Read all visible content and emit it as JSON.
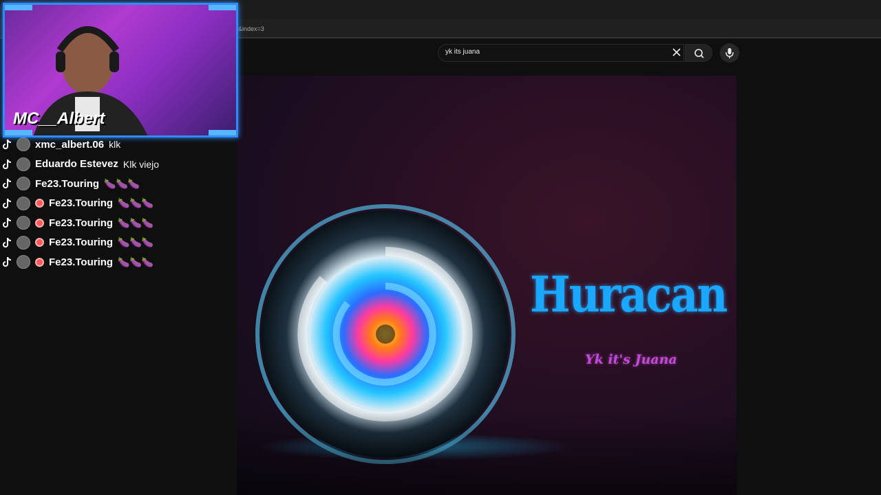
{
  "browser": {
    "url_fragment": "&index=3"
  },
  "search": {
    "value": "yk its juana"
  },
  "video": {
    "title": "Huracan",
    "artist": "Yk it's Juana"
  },
  "webcam": {
    "streamer_name": "MC__Albert"
  },
  "chat": {
    "messages": [
      {
        "user": "xmc_albert.06",
        "text": "klk",
        "badge": false
      },
      {
        "user": "Eduardo Estevez",
        "text": "Klk viejo",
        "badge": false
      },
      {
        "user": "Fe23.Touring",
        "text": "🍆🍆🍆",
        "badge": false
      },
      {
        "user": "Fe23.Touring",
        "text": "🍆🍆🍆",
        "badge": true
      },
      {
        "user": "Fe23.Touring",
        "text": "🍆🍆🍆",
        "badge": true
      },
      {
        "user": "Fe23.Touring",
        "text": "🍆🍆🍆",
        "badge": true
      },
      {
        "user": "Fe23.Touring",
        "text": "🍆🍆🍆",
        "badge": true
      }
    ]
  },
  "colors": {
    "cam_border": "#2f8cff",
    "title": "#1aa7ff",
    "subtitle": "#c24ad6"
  },
  "icons": [
    "tiktok-icon",
    "search-icon",
    "close-icon",
    "mic-icon"
  ]
}
